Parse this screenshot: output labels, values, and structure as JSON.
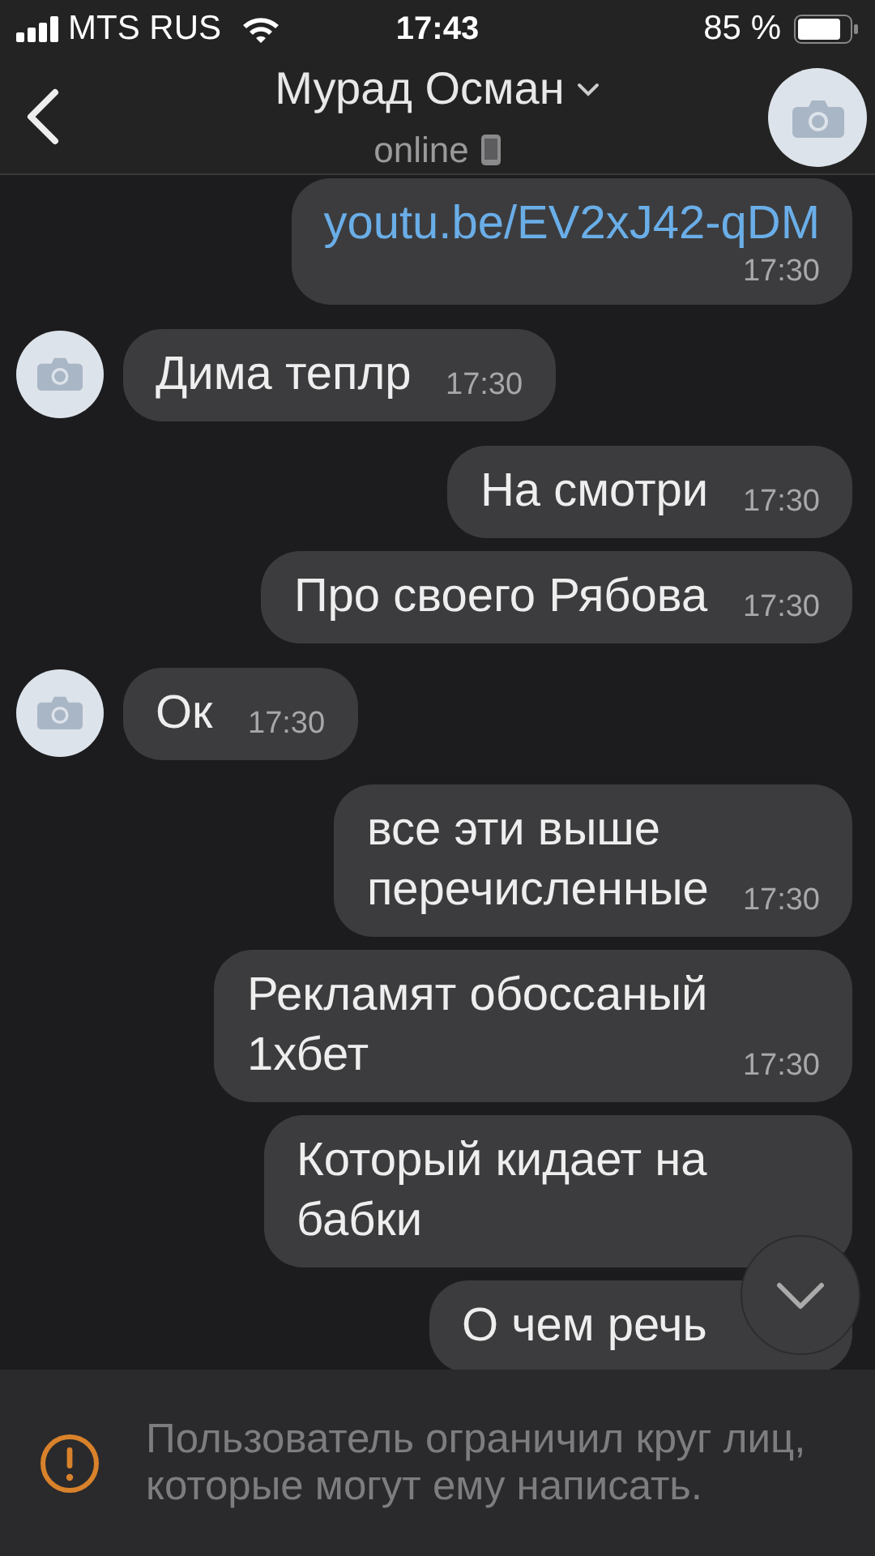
{
  "status_bar": {
    "carrier": "MTS RUS",
    "time": "17:43",
    "battery": "85 %"
  },
  "header": {
    "name": "Мурад Осман",
    "status": "online"
  },
  "messages": [
    {
      "incoming": false,
      "kind": "link",
      "text": "youtu.be/EV2xJ42-qDM",
      "time": "17:30"
    },
    {
      "incoming": true,
      "kind": "text",
      "text": "Дима теплр",
      "time": "17:30"
    },
    {
      "incoming": false,
      "kind": "text",
      "text": "На смотри",
      "time": "17:30"
    },
    {
      "incoming": false,
      "kind": "text",
      "text": "Про своего Рябова",
      "time": "17:30"
    },
    {
      "incoming": true,
      "kind": "text",
      "text": "Ок",
      "time": "17:30"
    },
    {
      "incoming": false,
      "kind": "text",
      "text": "все эти выше перечисленные",
      "time": "17:30"
    },
    {
      "incoming": false,
      "kind": "text",
      "text": "Рекламят обоссаный 1хбет",
      "time": "17:30"
    },
    {
      "incoming": false,
      "kind": "text",
      "text": "Который кидает на бабки"
    },
    {
      "incoming": false,
      "kind": "text",
      "text": "О чем речь"
    }
  ],
  "notice": {
    "text": "Пользователь ограничил круг лиц, которые могут ему написать."
  }
}
